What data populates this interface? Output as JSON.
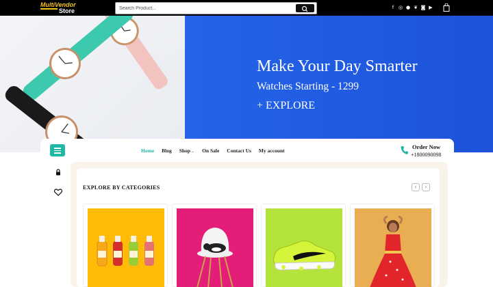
{
  "brand": {
    "name_line1": "MultiVendor",
    "name_line2": "Store"
  },
  "search": {
    "placeholder": "Search Product..."
  },
  "social_icons": [
    "facebook-icon",
    "instagram-icon",
    "pinterest-icon",
    "twitter-icon",
    "instagram-icon",
    "youtube-icon"
  ],
  "hero": {
    "title": "Make Your Day Smarter",
    "subtitle": "Watches Starting - 1299",
    "cta": "+ EXPLORE"
  },
  "nav": {
    "items": [
      "Home",
      "Blog",
      "Shop",
      "On Sale",
      "Contact Us",
      "My account"
    ],
    "active": "Home"
  },
  "order": {
    "label": "Order Now",
    "phone": "+1800090098"
  },
  "categories": {
    "title": "EXPLORE BY CATEGORIES",
    "prev": "‹",
    "next": "›",
    "cards": [
      "juice-bottles",
      "cat-on-chair",
      "sneaker",
      "woman-red-dress"
    ]
  },
  "colors": {
    "accent": "#1fb8a7",
    "hero_blue": "#2464e8",
    "topbar": "#000000",
    "brand_yellow": "#f5c518"
  }
}
